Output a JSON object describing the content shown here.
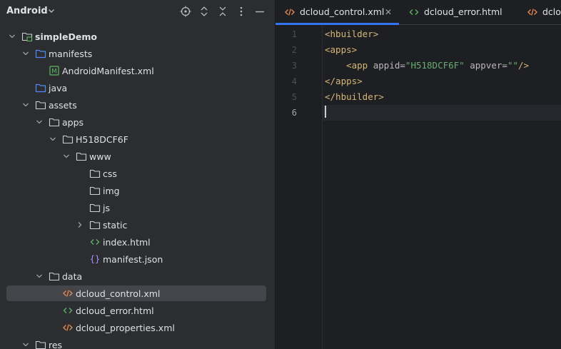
{
  "project_panel": {
    "title": "Android",
    "header_icons": [
      "locate-icon",
      "expand-all-icon",
      "collapse-all-icon",
      "more-vert-icon",
      "minimize-icon"
    ]
  },
  "tree": [
    {
      "label": "simpleDemo",
      "indent": 0,
      "chevron": "down",
      "icon": "module-folder",
      "bold": true
    },
    {
      "label": "manifests",
      "indent": 1,
      "chevron": "down",
      "icon": "source-folder"
    },
    {
      "label": "AndroidManifest.xml",
      "indent": 2,
      "chevron": "none",
      "icon": "manifest-file"
    },
    {
      "label": "java",
      "indent": 1,
      "chevron": "none",
      "icon": "source-folder"
    },
    {
      "label": "assets",
      "indent": 1,
      "chevron": "down",
      "icon": "folder"
    },
    {
      "label": "apps",
      "indent": 2,
      "chevron": "down",
      "icon": "folder"
    },
    {
      "label": "H518DCF6F",
      "indent": 3,
      "chevron": "down",
      "icon": "folder"
    },
    {
      "label": "www",
      "indent": 4,
      "chevron": "down",
      "icon": "folder"
    },
    {
      "label": "css",
      "indent": 5,
      "chevron": "none",
      "icon": "folder"
    },
    {
      "label": "img",
      "indent": 5,
      "chevron": "none",
      "icon": "folder"
    },
    {
      "label": "js",
      "indent": 5,
      "chevron": "none",
      "icon": "folder"
    },
    {
      "label": "static",
      "indent": 5,
      "chevron": "right",
      "icon": "folder"
    },
    {
      "label": "index.html",
      "indent": 5,
      "chevron": "none",
      "icon": "html-file"
    },
    {
      "label": "manifest.json",
      "indent": 5,
      "chevron": "none",
      "icon": "json-file"
    },
    {
      "label": "data",
      "indent": 2,
      "chevron": "down",
      "icon": "folder"
    },
    {
      "label": "dcloud_control.xml",
      "indent": 3,
      "chevron": "none",
      "icon": "xml-file",
      "selected": true
    },
    {
      "label": "dcloud_error.html",
      "indent": 3,
      "chevron": "none",
      "icon": "html-file"
    },
    {
      "label": "dcloud_properties.xml",
      "indent": 3,
      "chevron": "none",
      "icon": "xml-file"
    },
    {
      "label": "res",
      "indent": 1,
      "chevron": "down",
      "icon": "folder"
    }
  ],
  "editor": {
    "tabs": [
      {
        "label": "dcloud_control.xml",
        "icon": "xml-file",
        "active": true,
        "closable": true
      },
      {
        "label": "dcloud_error.html",
        "icon": "html-file",
        "active": false
      },
      {
        "label": "dcloud_properties.xml",
        "icon": "xml-file",
        "active": false
      }
    ],
    "line_numbers": [
      "1",
      "2",
      "3",
      "4",
      "5",
      "6"
    ],
    "current_line": 6,
    "code": [
      {
        "indent": "",
        "tokens": [
          [
            "tag",
            "<hbuilder>"
          ]
        ]
      },
      {
        "indent": "",
        "tokens": [
          [
            "tag",
            "<apps>"
          ]
        ]
      },
      {
        "indent": "    ",
        "tokens": [
          [
            "tag",
            "<app "
          ],
          [
            "attr",
            "appid"
          ],
          [
            "pun",
            "="
          ],
          [
            "str",
            "\"H518DCF6F\""
          ],
          [
            "attr",
            " appver"
          ],
          [
            "pun",
            "="
          ],
          [
            "str",
            "\"\""
          ],
          [
            "tag",
            "/>"
          ]
        ]
      },
      {
        "indent": "",
        "tokens": [
          [
            "tag",
            "</apps>"
          ]
        ]
      },
      {
        "indent": "",
        "tokens": [
          [
            "tag",
            "</hbuilder>"
          ]
        ]
      },
      {
        "indent": "",
        "tokens": []
      }
    ]
  },
  "colors": {
    "panel_bg": "#2b2d30",
    "editor_bg": "#1e1f22",
    "accent": "#3574f0",
    "tag": "#d5b778",
    "string": "#6aab73"
  }
}
